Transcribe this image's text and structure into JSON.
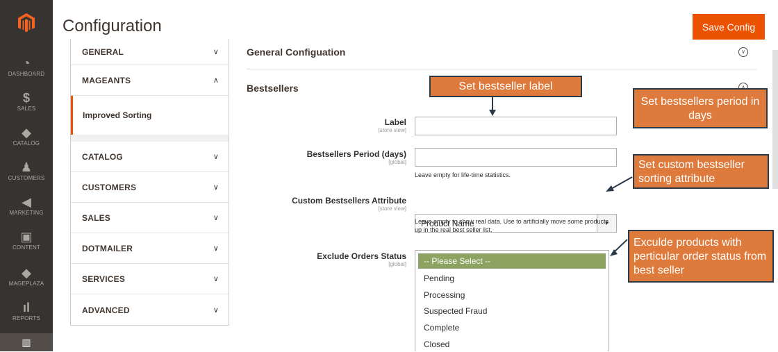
{
  "nav": {
    "items": [
      {
        "label": "DASHBOARD",
        "icon": "gauge-icon"
      },
      {
        "label": "SALES",
        "icon": "dollar-icon"
      },
      {
        "label": "CATALOG",
        "icon": "box-icon"
      },
      {
        "label": "CUSTOMERS",
        "icon": "person-icon"
      },
      {
        "label": "MARKETING",
        "icon": "megaphone-icon"
      },
      {
        "label": "CONTENT",
        "icon": "layout-icon"
      },
      {
        "label": "MAGEPLAZA",
        "icon": "box-icon"
      },
      {
        "label": "REPORTS",
        "icon": "bar-chart-icon"
      }
    ]
  },
  "header": {
    "title": "Configuration",
    "save_label": "Save Config"
  },
  "sidebar": {
    "items": [
      {
        "label": "GENERAL",
        "chevron": "down"
      },
      {
        "label": "MAGEANTS",
        "chevron": "up"
      },
      {
        "label": "CATALOG",
        "chevron": "down"
      },
      {
        "label": "CUSTOMERS",
        "chevron": "down"
      },
      {
        "label": "SALES",
        "chevron": "down"
      },
      {
        "label": "DOTMAILER",
        "chevron": "down"
      },
      {
        "label": "SERVICES",
        "chevron": "down"
      },
      {
        "label": "ADVANCED",
        "chevron": "down"
      }
    ],
    "active_sub": "Improved Sorting"
  },
  "main": {
    "section1": "General Configuation",
    "section2": "Bestsellers",
    "fields": {
      "label": {
        "label": "Label",
        "scope": "[store view]",
        "value": ""
      },
      "period": {
        "label": "Bestsellers Period (days)",
        "scope": "[global]",
        "value": "",
        "note": "Leave empty for life-time statistics."
      },
      "attr": {
        "label": "Custom Bestsellers Attribute",
        "scope": "[store view]",
        "value": "Product Name",
        "note": "Leave empty to show real data. Use to artificially move some products up in the real best seller list."
      },
      "status": {
        "label": "Exclude Orders Status",
        "scope": "[global]",
        "options": [
          "-- Please Select --",
          "Pending",
          "Processing",
          "Suspected Fraud",
          "Complete",
          "Closed"
        ]
      }
    }
  },
  "callouts": {
    "c1": "Set bestseller label",
    "c2": "Set bestsellers period in days",
    "c3": "Set custom bestseller sorting attribute",
    "c4": "Exculde products with perticular order status from best seller"
  },
  "colors": {
    "accent": "#eb5202",
    "nav_bg": "#373330",
    "callout": "#de7a3c",
    "selected_option": "#8da361"
  }
}
